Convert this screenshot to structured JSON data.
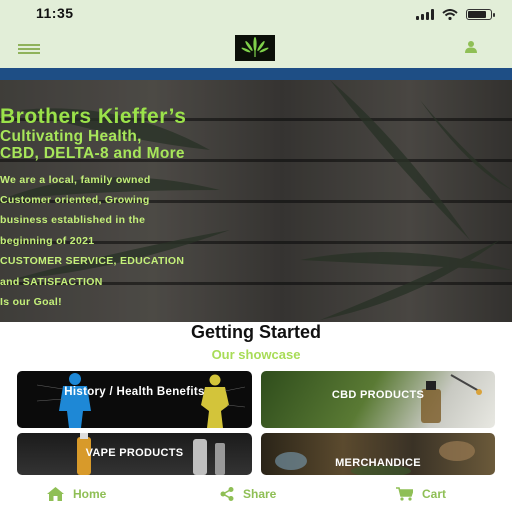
{
  "status_bar": {
    "time": "11:35",
    "battery_level": 0.8
  },
  "header": {
    "logo_alt": "Brothers Kieffer's logo"
  },
  "hero": {
    "title": "Brothers Kieffer’s",
    "subtitle_lines": [
      "Cultivating Health,",
      "CBD, DELTA-8 and More"
    ],
    "lines": [
      "We are a local, family owned",
      "Customer oriented, Growing",
      "business established in the",
      "beginning of 2021",
      "CUSTOMER SERVICE, EDUCATION",
      "and SATISFACTION",
      "Is our Goal!"
    ]
  },
  "section": {
    "title": "Getting Started",
    "subtitle": "Our showcase"
  },
  "cards": [
    {
      "label": "History / Health Benefits"
    },
    {
      "label": "CBD PRODUCTS"
    },
    {
      "label": "VAPE PRODUCTS"
    },
    {
      "label": "MERCHANDICE"
    }
  ],
  "bottom_nav": [
    {
      "label": "Home",
      "icon": "home-icon"
    },
    {
      "label": "Share",
      "icon": "share-icon"
    },
    {
      "label": "Cart",
      "icon": "cart-icon"
    }
  ],
  "colors": {
    "accent_green": "#9be24a",
    "nav_green": "#8fbf55",
    "header_bg": "#e2eed8",
    "rule_blue": "#1e4e85"
  }
}
